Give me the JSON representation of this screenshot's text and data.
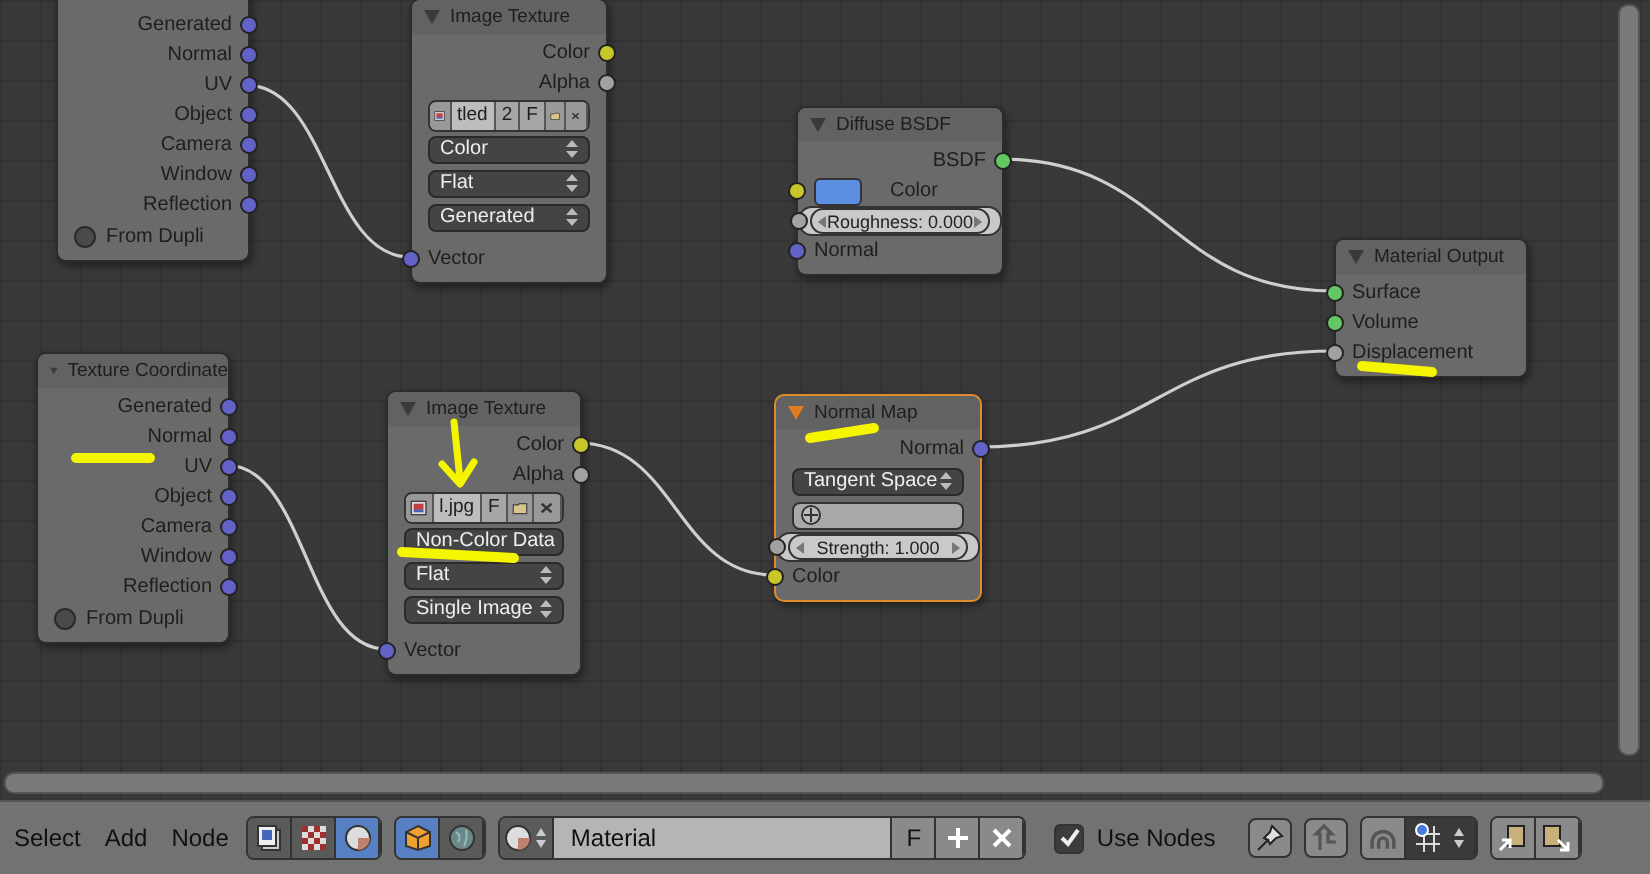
{
  "nodes": [
    {
      "selected": false,
      "rows": [
        {
          "kind": "output",
          "label": "Generated",
          "color": "#6363c7"
        },
        {
          "kind": "output",
          "label": "Normal",
          "color": "#6363c7"
        },
        {
          "kind": "output",
          "label": "UV",
          "color": "#6363c7"
        },
        {
          "kind": "output",
          "label": "Object",
          "color": "#6363c7"
        },
        {
          "kind": "output",
          "label": "Camera",
          "color": "#6363c7"
        },
        {
          "kind": "output",
          "label": "Window",
          "color": "#6363c7"
        },
        {
          "kind": "output",
          "label": "Reflection",
          "color": "#6363c7"
        },
        {
          "kind": "checkbox",
          "label": "From Dupli",
          "checked": false
        }
      ]
    },
    {
      "title": "Image Texture",
      "selected": false,
      "rows": [
        {
          "kind": "output",
          "label": "Color",
          "color": "#c7c729"
        },
        {
          "kind": "output",
          "label": "Alpha",
          "color": "#a1a1a1"
        },
        {
          "kind": "image",
          "name": "tled",
          "users": "2",
          "fake_user": "F"
        },
        {
          "kind": "dropdown",
          "value": "Color"
        },
        {
          "kind": "dropdown",
          "value": "Flat"
        },
        {
          "kind": "dropdown",
          "value": "Generated"
        },
        {
          "kind": "input",
          "label": "Vector",
          "color": "#6363c7"
        }
      ]
    },
    {
      "title": "Diffuse BSDF",
      "selected": false,
      "rows": [
        {
          "kind": "output",
          "label": "BSDF",
          "color": "#63c763"
        },
        {
          "kind": "color_input",
          "label": "Color",
          "color": "#c7c729",
          "value": {
            "color": "#5b8fe0"
          }
        },
        {
          "kind": "slider",
          "label": "Roughness: 0.000",
          "color": "#a1a1a1"
        },
        {
          "kind": "input",
          "label": "Normal",
          "color": "#6363c7"
        }
      ]
    },
    {
      "title": "Material Output",
      "selected": false,
      "rows": [
        {
          "kind": "input",
          "label": "Surface",
          "color": "#63c763"
        },
        {
          "kind": "input",
          "label": "Volume",
          "color": "#63c763"
        },
        {
          "kind": "input",
          "label": "Displacement",
          "color": "#a1a1a1"
        }
      ]
    },
    {
      "title": "Texture Coordinate",
      "selected": false,
      "rows": [
        {
          "kind": "output",
          "label": "Generated",
          "color": "#6363c7"
        },
        {
          "kind": "output",
          "label": "Normal",
          "color": "#6363c7"
        },
        {
          "kind": "output",
          "label": "UV",
          "color": "#6363c7"
        },
        {
          "kind": "output",
          "label": "Object",
          "color": "#6363c7"
        },
        {
          "kind": "output",
          "label": "Camera",
          "color": "#6363c7"
        },
        {
          "kind": "output",
          "label": "Window",
          "color": "#6363c7"
        },
        {
          "kind": "output",
          "label": "Reflection",
          "color": "#6363c7"
        },
        {
          "kind": "checkbox",
          "label": "From Dupli",
          "checked": false
        }
      ]
    },
    {
      "title": "Image Texture",
      "selected": false,
      "rows": [
        {
          "kind": "output",
          "label": "Color",
          "color": "#c7c729"
        },
        {
          "kind": "output",
          "label": "Alpha",
          "color": "#a1a1a1"
        },
        {
          "kind": "image",
          "name": "l.jpg",
          "fake_user": "F"
        },
        {
          "kind": "dropdown",
          "value": "Non-Color Data"
        },
        {
          "kind": "dropdown",
          "value": "Flat"
        },
        {
          "kind": "dropdown",
          "value": "Single Image"
        },
        {
          "kind": "input",
          "label": "Vector",
          "color": "#6363c7"
        }
      ]
    },
    {
      "title": "Normal Map",
      "selected": true,
      "rows": [
        {
          "kind": "output",
          "label": "Normal",
          "color": "#6363c7"
        },
        {
          "kind": "dropdown",
          "value": "Tangent Space"
        },
        {
          "kind": "field"
        },
        {
          "kind": "slider",
          "label": "Strength: 1.000",
          "color": "#a1a1a1"
        },
        {
          "kind": "input",
          "label": "Color",
          "color": "#c7c729"
        }
      ]
    }
  ],
  "toolbar": {
    "menus": [
      "Select",
      "Add",
      "Node"
    ],
    "shader_types": [
      {
        "selected": false
      },
      {
        "selected": false
      },
      {
        "selected": true
      }
    ],
    "object_types": [
      {
        "selected": true
      },
      {
        "selected": false
      }
    ],
    "material": {
      "name": "Material",
      "fake_user": "F"
    },
    "use_nodes": {
      "label": "Use Nodes",
      "checked": true
    }
  }
}
